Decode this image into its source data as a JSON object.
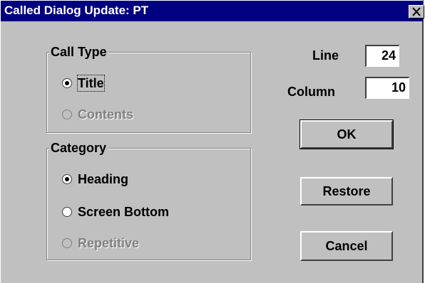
{
  "window": {
    "title": "Called Dialog Update: PT",
    "close_glyph": "X"
  },
  "call_type": {
    "legend": "Call Type",
    "options": [
      {
        "label": "Title",
        "checked": true,
        "enabled": true,
        "focused": true
      },
      {
        "label": "Contents",
        "checked": false,
        "enabled": false
      }
    ]
  },
  "category": {
    "legend": "Category",
    "options": [
      {
        "label": "Heading",
        "checked": true,
        "enabled": true
      },
      {
        "label": "Screen Bottom",
        "checked": false,
        "enabled": true
      },
      {
        "label": "Repetitive",
        "checked": false,
        "enabled": false
      }
    ]
  },
  "position": {
    "line_label": "Line",
    "line_value": "24",
    "column_label": "Column",
    "column_value": "10"
  },
  "buttons": {
    "ok": "OK",
    "restore": "Restore",
    "cancel": "Cancel"
  },
  "colors": {
    "face": "#c0c0c0",
    "title_bar": "#000080",
    "disabled_text": "#808080"
  },
  "icons": {
    "close": "close-icon",
    "radio": "radio-button"
  }
}
